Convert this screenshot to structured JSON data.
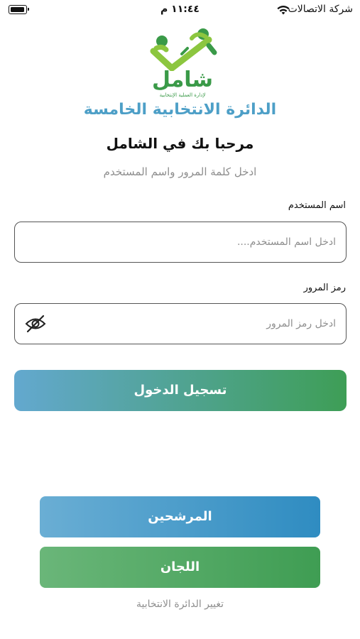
{
  "status_bar": {
    "carrier": "شركة الاتصالات",
    "time": "١١:٤٤ م"
  },
  "logo": {
    "word": "شامل",
    "tagline": "لإدارة العملية الإنتخابية",
    "colors": {
      "green": "#3a9a48",
      "light_green": "#8cc63f"
    }
  },
  "header": {
    "district_title": "الدائرة الانتخابية الخامسة",
    "welcome": "مرحبا بك في الشامل",
    "instruction": "ادخل كلمة المرور واسم المستخدم"
  },
  "form": {
    "username": {
      "label": "اسم المستخدم",
      "placeholder": "ادخل اسم المستخدم....",
      "value": ""
    },
    "password": {
      "label": "رمز المرور",
      "placeholder": "ادخل رمز المرور",
      "value": "",
      "toggle_icon": "eye-slash-icon"
    },
    "login_label": "تسجيل الدخول"
  },
  "actions": {
    "candidates_label": "المرشحين",
    "committees_label": "اللجان",
    "change_district_label": "تغيير الدائرة الانتخابية"
  },
  "colors": {
    "title_blue": "#4d9fc7",
    "login_gradient": [
      "#63a8cf",
      "#3e9e56"
    ],
    "candidates_gradient": [
      "#6aaed4",
      "#2f8cc1"
    ],
    "committees_gradient": [
      "#6ab679",
      "#3f9d53"
    ],
    "muted_text": "#8e8e8e"
  }
}
